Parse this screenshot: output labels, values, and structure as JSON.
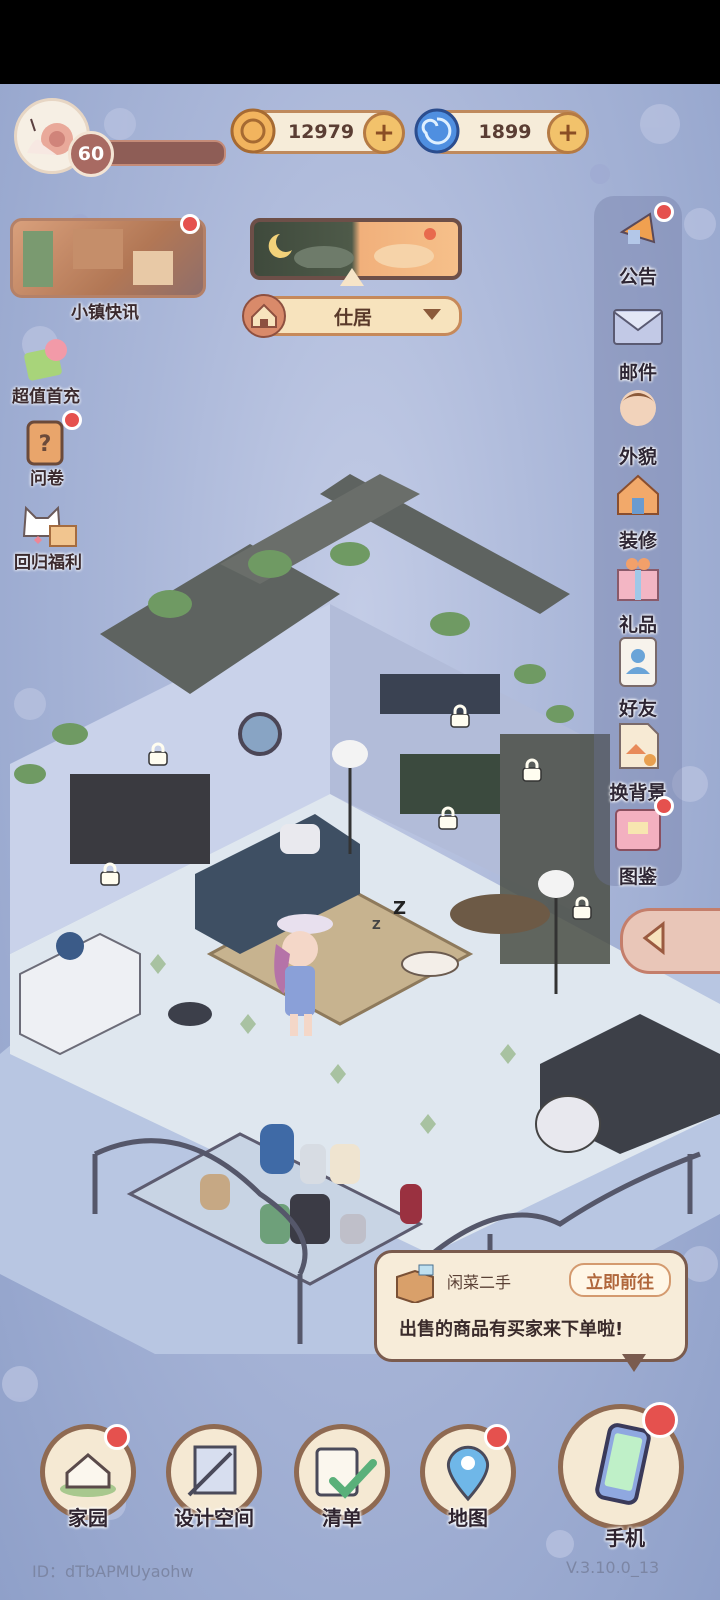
{
  "player": {
    "level": "60"
  },
  "currencies": [
    {
      "name": "coin",
      "value": "12979",
      "color": "#f2b45e"
    },
    {
      "name": "gem",
      "value": "1899",
      "color": "#4f8fe0"
    }
  ],
  "left_menu": {
    "news": "小镇快讯",
    "first_recharge": "超值首充",
    "survey": "问卷",
    "return_bonus": "回归福利"
  },
  "location": {
    "name": "仕居"
  },
  "right_menu": [
    {
      "label": "公告",
      "icon": "announcement-icon"
    },
    {
      "label": "邮件",
      "icon": "mail-icon"
    },
    {
      "label": "外貌",
      "icon": "appearance-icon"
    },
    {
      "label": "装修",
      "icon": "decorate-icon"
    },
    {
      "label": "礼品",
      "icon": "gift-icon"
    },
    {
      "label": "好友",
      "icon": "friends-icon"
    },
    {
      "label": "换背景",
      "icon": "background-icon"
    },
    {
      "label": "图鉴",
      "icon": "collection-icon"
    }
  ],
  "notification": {
    "title": "闲菜二手",
    "button": "立即前往",
    "message": "出售的商品有买家来下单啦!"
  },
  "bottom_nav": [
    {
      "label": "家园",
      "icon": "home-icon"
    },
    {
      "label": "设计空间",
      "icon": "design-icon"
    },
    {
      "label": "清单",
      "icon": "checklist-icon"
    },
    {
      "label": "地图",
      "icon": "map-pin-icon"
    },
    {
      "label": "手机",
      "icon": "phone-icon"
    }
  ],
  "footer": {
    "id": "ID：dTbAPMUyaohw",
    "version": "V.3.10.0_13"
  },
  "scene": {
    "sleep_mark": "Z"
  }
}
